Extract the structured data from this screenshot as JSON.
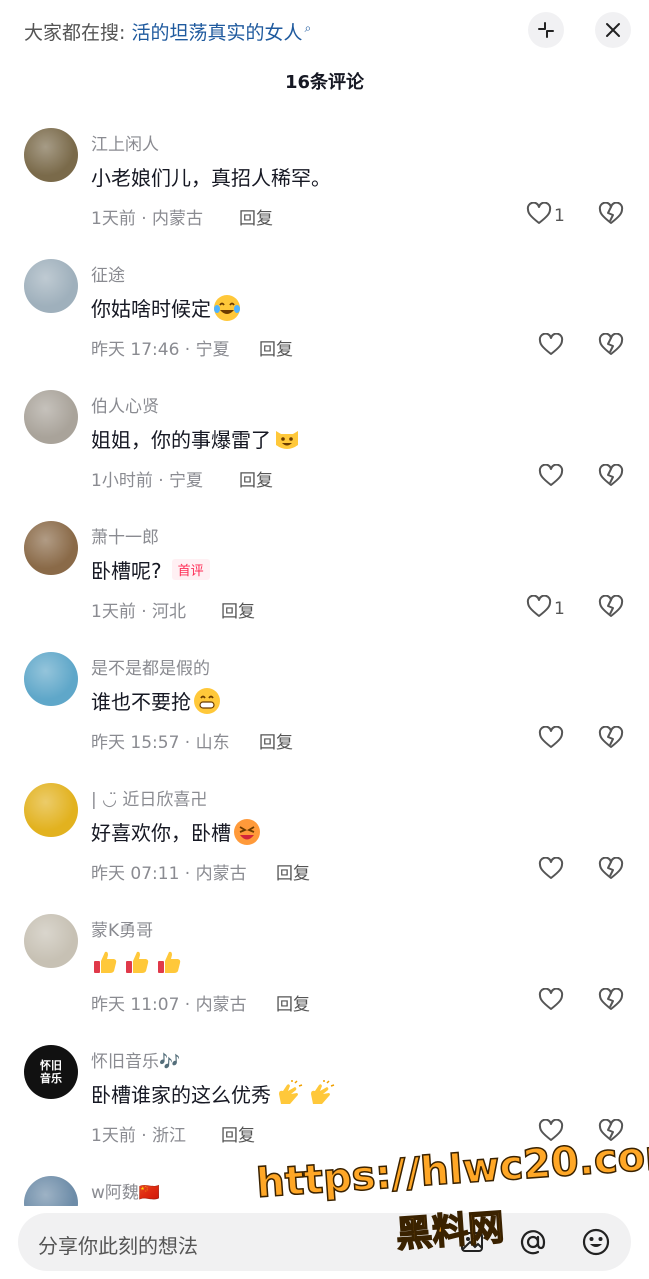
{
  "header": {
    "search_prefix": "大家都在搜: ",
    "search_query": "活的坦荡真实的女人",
    "comment_count_label": "16条评论"
  },
  "comments": [
    {
      "username": "江上闲人",
      "text": "小老娘们儿，真招人稀罕。",
      "time_location": "1天前 · 内蒙古",
      "reply_label": "回复",
      "like_count": "1",
      "avatar_color": "#7a6a4a"
    },
    {
      "username": "征途",
      "text": "你姑啥时候定",
      "emoji": "crying-laughing-face",
      "time_location": "昨天 17:46 · 宁夏",
      "reply_label": "回复",
      "like_count": "",
      "avatar_color": "#9fb0bc"
    },
    {
      "username": "伯人心贤",
      "text": "姐姐，你的事爆雷了",
      "emoji": "grinning-cat-face",
      "time_location": "1小时前 · 宁夏",
      "reply_label": "回复",
      "like_count": "",
      "avatar_color": "#a9a39a"
    },
    {
      "username": "萧十一郎",
      "text": "卧槽呢?",
      "tag": "首评",
      "time_location": "1天前 · 河北",
      "reply_label": "回复",
      "like_count": "1",
      "avatar_color": "#8a6a48"
    },
    {
      "username": "是不是都是假的",
      "text": "谁也不要抢",
      "emoji": "grinning-face",
      "time_location": "昨天 15:57 · 山东",
      "reply_label": "回复",
      "like_count": "",
      "avatar_color": "#5fa7c9"
    },
    {
      "username": "| ◡̈ 近日欣喜卍",
      "text": "好喜欢你，卧槽",
      "emoji": "laughing-face",
      "time_location": "昨天 07:11 · 内蒙古",
      "reply_label": "回复",
      "like_count": "",
      "avatar_color": "#e2b21f"
    },
    {
      "username": "蒙K勇哥",
      "text": "",
      "emoji_hands": 3,
      "time_location": "昨天 11:07 · 内蒙古",
      "reply_label": "回复",
      "like_count": "",
      "avatar_color": "#c7c1b4"
    },
    {
      "username": "怀旧音乐🎶",
      "text": "卧槽谁家的这么优秀",
      "emoji_clap": 2,
      "time_location": "1天前 · 浙江",
      "reply_label": "回复",
      "like_count": "",
      "avatar_color": "#111111",
      "avatar_text": "怀旧\n音乐"
    },
    {
      "username": "w阿魏🇨🇳",
      "text": "",
      "time_location": "",
      "reply_label": "",
      "like_count": "",
      "avatar_color": "#6d8ca8"
    }
  ],
  "input": {
    "placeholder": "分享你此刻的想法"
  },
  "watermark": {
    "line1": "https://hlwc20.com",
    "line2": "黑料网"
  },
  "colors": {
    "accent_blue": "#1f5a9e",
    "muted_text": "#8a8b91",
    "primary_text": "#161823",
    "first_tag": "#fe2c55",
    "input_bg": "#f1f1f2"
  },
  "icons": [
    "shrink-icon",
    "close-icon",
    "heart-icon",
    "dislike-heart-icon",
    "image-icon",
    "at-icon",
    "emoji-icon"
  ]
}
